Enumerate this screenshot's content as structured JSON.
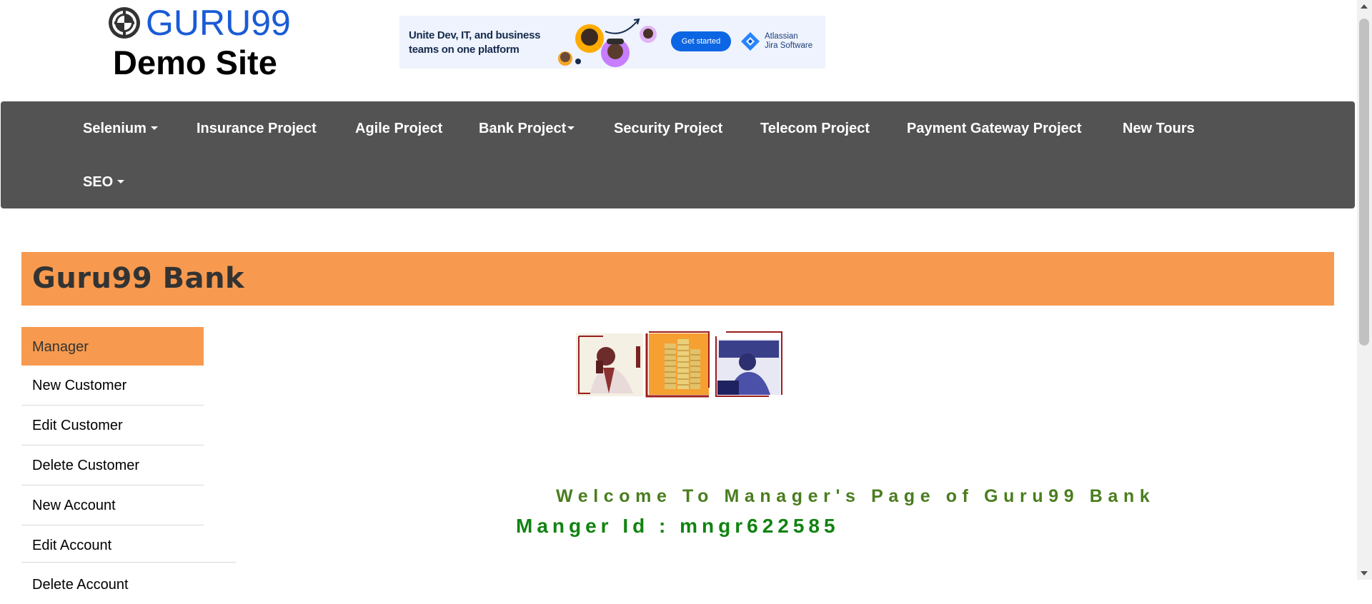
{
  "header": {
    "logo_brand": "GURU99",
    "logo_subtitle": "Demo Site"
  },
  "ad": {
    "headline": "Unite Dev, IT, and business teams on one platform",
    "cta_label": "Get started",
    "brand_line1": "Atlassian",
    "brand_line2": "Jira Software"
  },
  "nav": {
    "items": [
      {
        "label": "Selenium",
        "dropdown": true
      },
      {
        "label": "Insurance Project",
        "dropdown": false
      },
      {
        "label": "Agile Project",
        "dropdown": false
      },
      {
        "label": "Bank Project",
        "dropdown": true
      },
      {
        "label": "Security Project",
        "dropdown": false
      },
      {
        "label": "Telecom Project",
        "dropdown": false
      },
      {
        "label": "Payment Gateway Project",
        "dropdown": false
      },
      {
        "label": "New Tours",
        "dropdown": false
      },
      {
        "label": "SEO",
        "dropdown": true
      }
    ]
  },
  "bank": {
    "title": "Guru99 Bank"
  },
  "sidebar": {
    "items": [
      {
        "label": "Manager",
        "active": true
      },
      {
        "label": "New Customer"
      },
      {
        "label": "Edit Customer"
      },
      {
        "label": "Delete Customer"
      },
      {
        "label": "New Account"
      },
      {
        "label": "Edit Account"
      },
      {
        "label": "Delete Account"
      }
    ]
  },
  "main": {
    "welcome_text": "Welcome To Manager's Page of Guru99 Bank",
    "manager_id_text": "Manger Id : mngr622585"
  },
  "colors": {
    "nav_bg": "#535353",
    "accent_orange": "#f79a4f",
    "welcome_green": "#4a7d1e",
    "manager_id_green": "#118311",
    "logo_blue": "#1a5bd6"
  }
}
